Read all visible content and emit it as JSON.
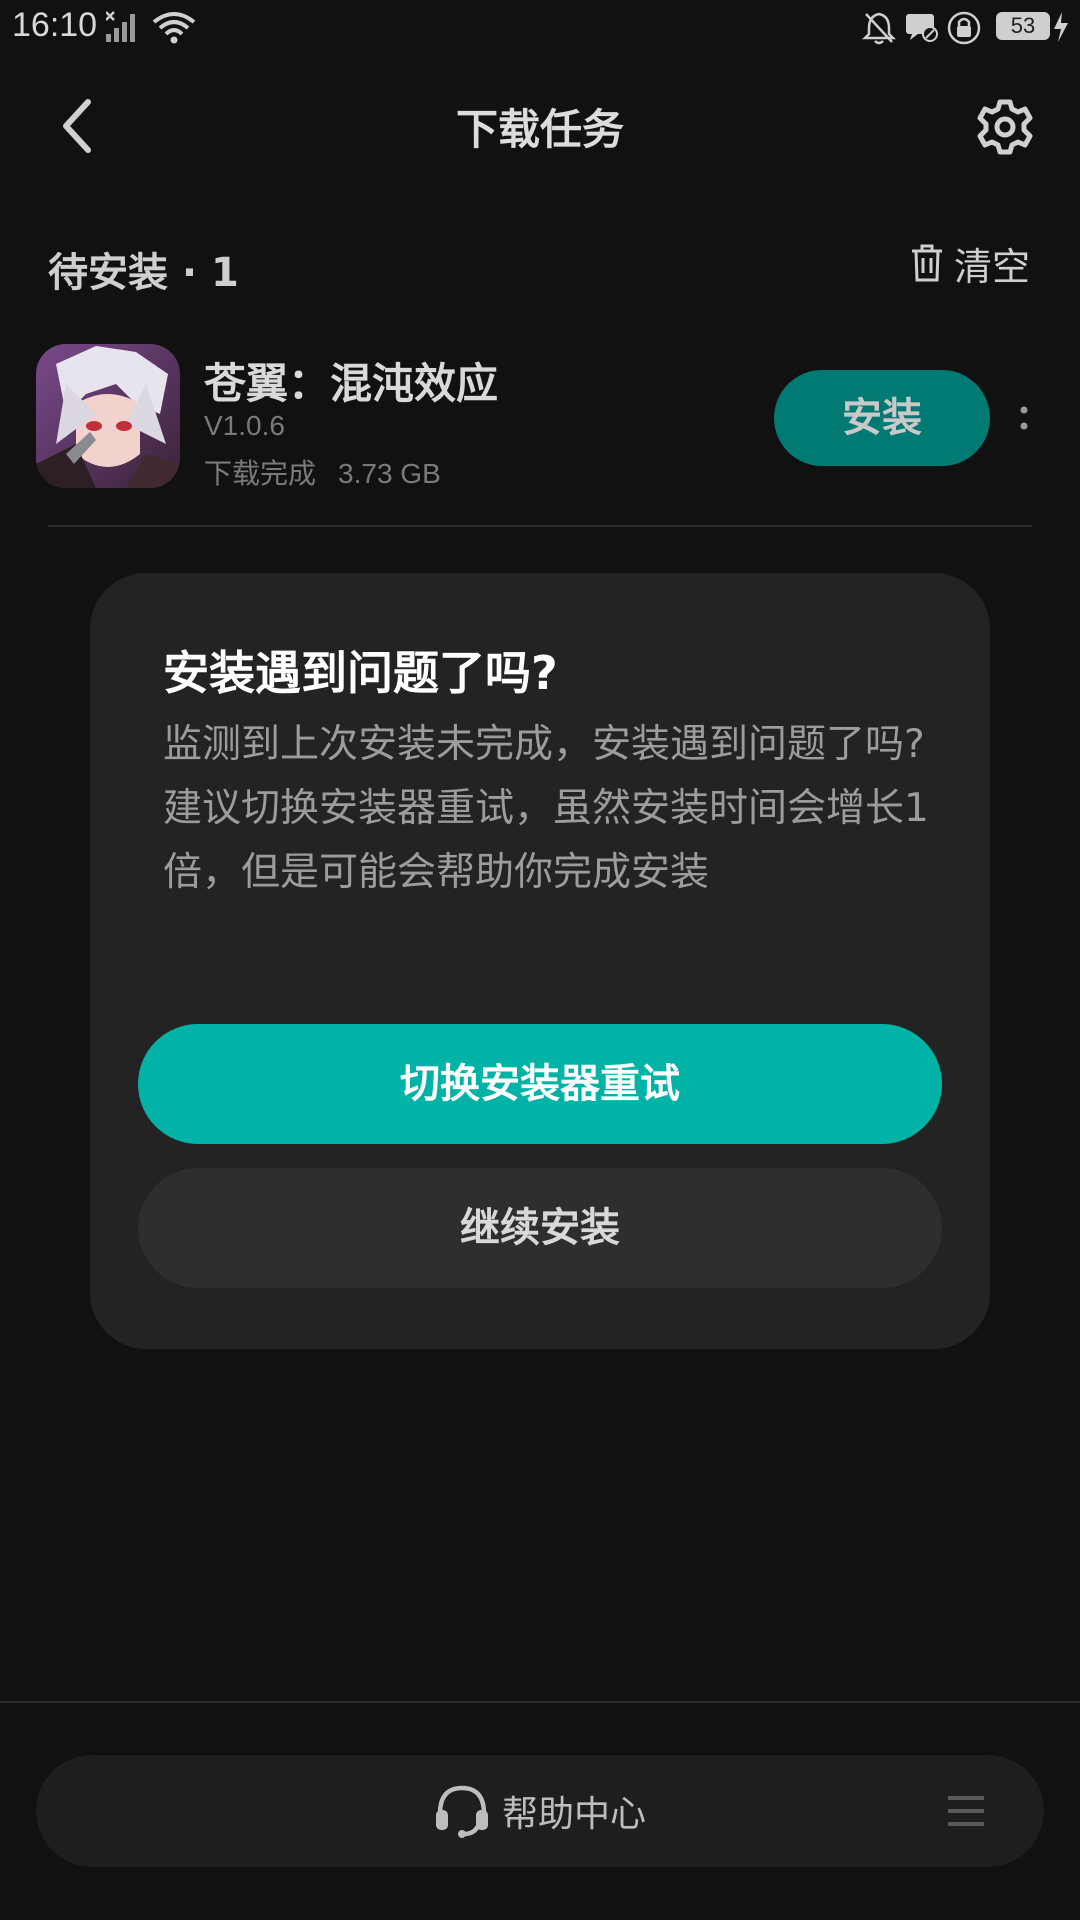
{
  "status_bar": {
    "time": "16:10",
    "battery": "53",
    "icons": [
      "signal-x-icon",
      "wifi-icon",
      "bell-off-icon",
      "notification-off-icon",
      "lock-rotation-icon",
      "battery-icon",
      "charging-icon"
    ]
  },
  "header": {
    "title": "下载任务",
    "back_icon": "back-chevron-icon",
    "settings_icon": "gear-icon"
  },
  "section": {
    "title": "待安装 · 1",
    "clear_label": "清空",
    "clear_icon": "trash-icon"
  },
  "app": {
    "name": "苍翼：混沌效应",
    "version": "V1.0.6",
    "status": "下载完成",
    "size": "3.73 GB",
    "install_label": "安装",
    "more_icon": "more-vertical-icon"
  },
  "dialog": {
    "title": "安装遇到问题了吗?",
    "body_line1": "监测到上次安装未完成，安装遇到问题了吗?",
    "body_line2": "建议切换安装器重试，虽然安装时间会增长1倍，但是可能会帮助你完成安装",
    "primary_label": "切换安装器重试",
    "secondary_label": "继续安装"
  },
  "bottom": {
    "help_label": "帮助中心",
    "help_icon": "headset-icon",
    "menu_icon": "menu-icon"
  },
  "colors": {
    "background": "#111111",
    "accent": "#00b3a6",
    "install_button": "#007a72",
    "dialog": "#232323"
  }
}
